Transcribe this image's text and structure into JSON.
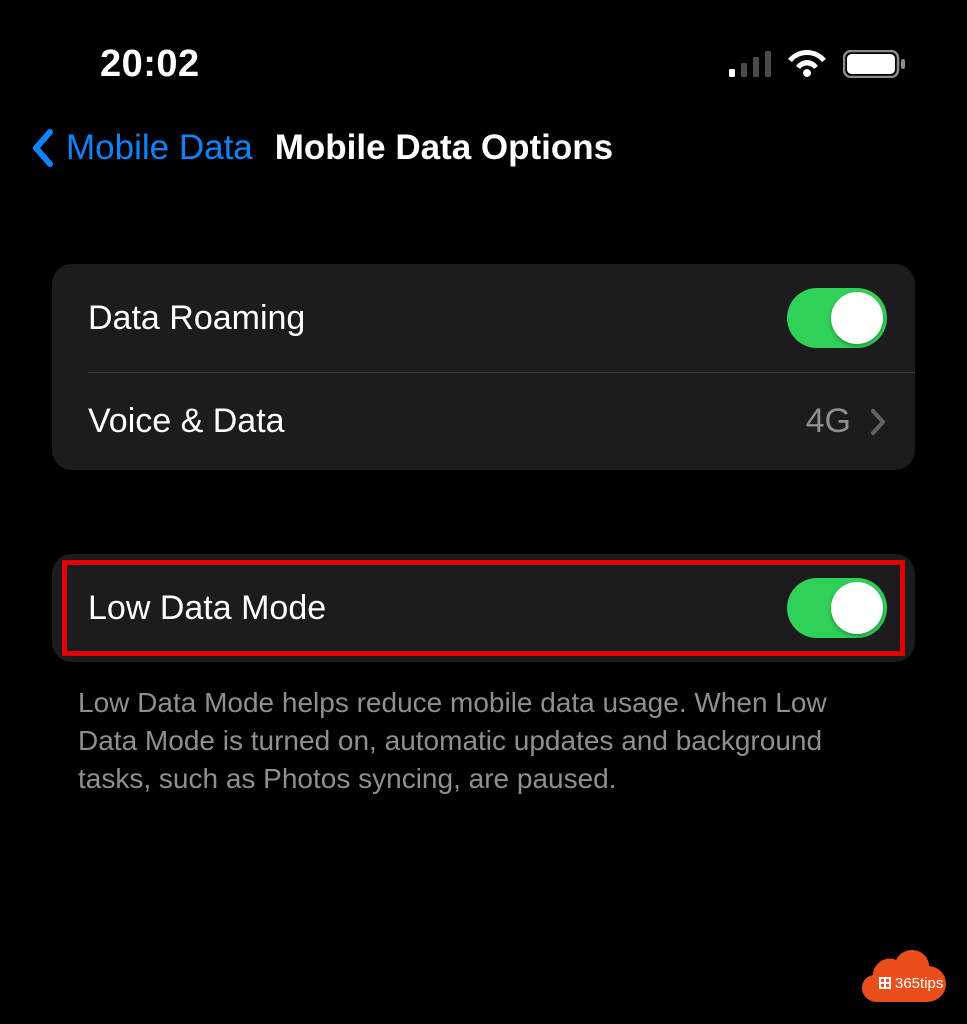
{
  "status": {
    "time": "20:02"
  },
  "nav": {
    "back_label": "Mobile Data",
    "title": "Mobile Data Options"
  },
  "group1": {
    "data_roaming": {
      "label": "Data Roaming",
      "on": true
    },
    "voice_data": {
      "label": "Voice & Data",
      "value": "4G"
    }
  },
  "group2": {
    "low_data_mode": {
      "label": "Low Data Mode",
      "on": true
    },
    "footer": "Low Data Mode helps reduce mobile data usage. When Low Data Mode is turned on, automatic updates and background tasks, such as Photos syncing, are paused."
  },
  "watermark": {
    "text": "365tips"
  }
}
